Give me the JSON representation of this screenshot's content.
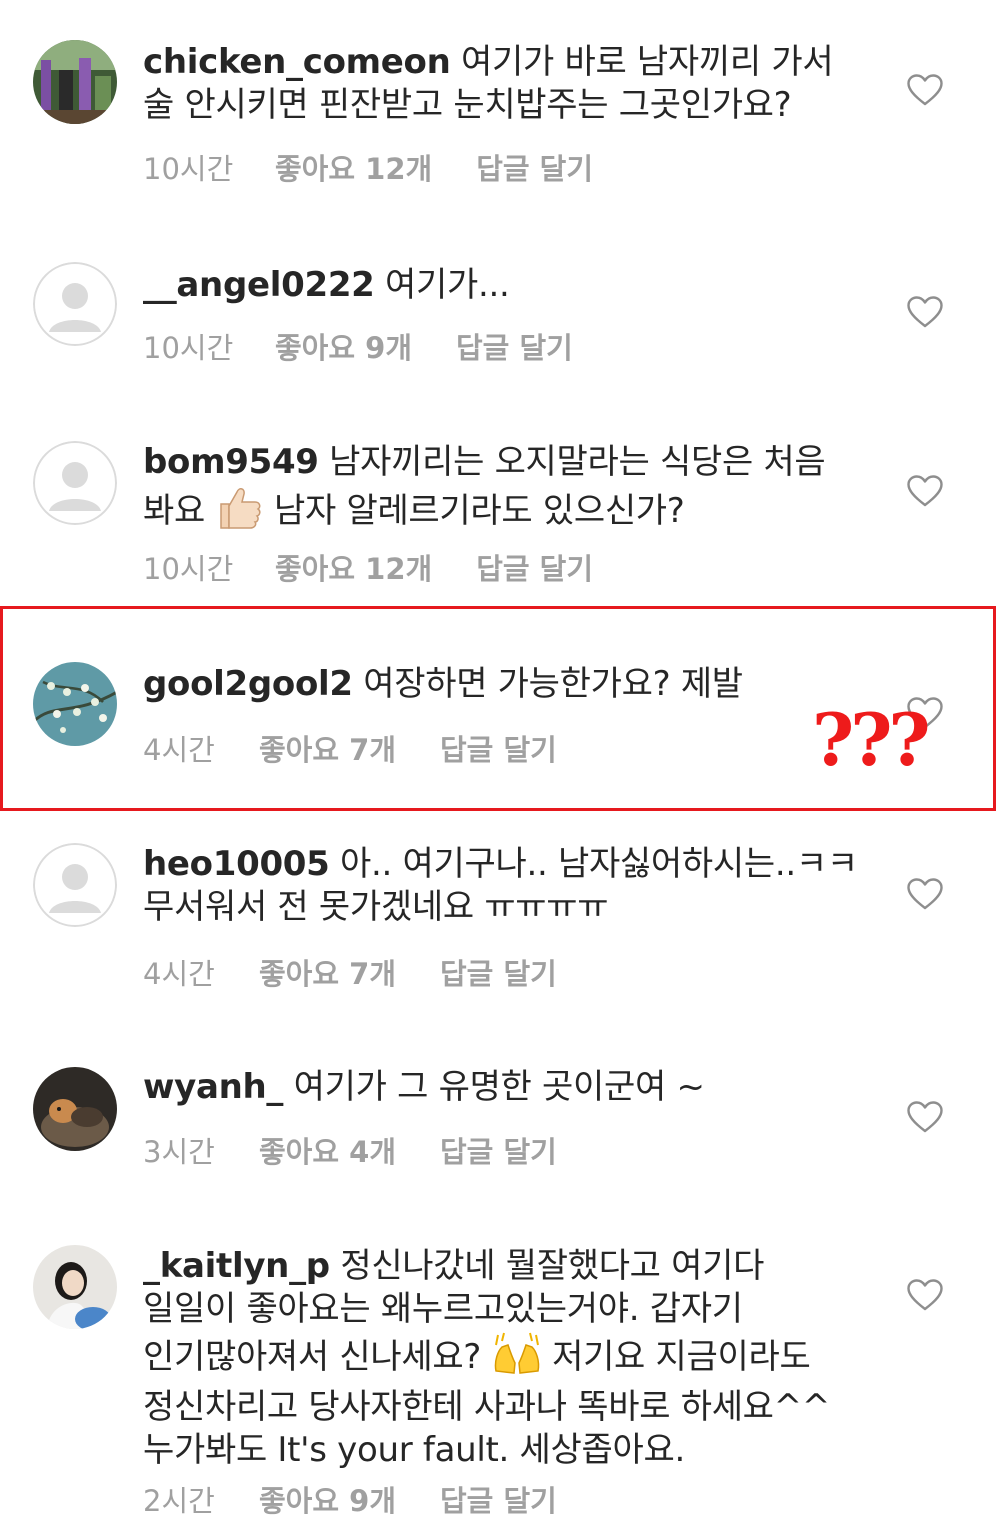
{
  "comments": [
    {
      "username": "chicken_comeon",
      "text": "여기가 바로 남자끼리 가서 술 안시키면 핀잔받고 눈치밥주는 그곳인가요?",
      "time": "10시간",
      "likes": "좋아요 12개",
      "reply": "답글 달기"
    },
    {
      "username": "__angel0222",
      "text": "여기가...",
      "time": "10시간",
      "likes": "좋아요 9개",
      "reply": "답글 달기"
    },
    {
      "username": "bom9549",
      "text_before": "남자끼리는 오지말라는 식당은 처음 봐요",
      "emoji": "thumbs-up-icon",
      "text_after": "남자 알레르기라도 있으신가?",
      "time": "10시간",
      "likes": "좋아요 12개",
      "reply": "답글 달기"
    },
    {
      "username": "gool2gool2",
      "text": "여장하면 가능한가요? 제발",
      "time": "4시간",
      "likes": "좋아요 7개",
      "reply": "답글 달기"
    },
    {
      "username": "heo10005",
      "text": "아.. 여기구나.. 남자싫어하시는..ㅋㅋ 무서워서 전 못가겠네요 ㅠㅠㅠㅠ",
      "time": "4시간",
      "likes": "좋아요 7개",
      "reply": "답글 달기"
    },
    {
      "username": "wyanh_",
      "text": "여기가 그 유명한 곳이군여 ~",
      "time": "3시간",
      "likes": "좋아요 4개",
      "reply": "답글 달기"
    },
    {
      "username": "_kaitlyn_p",
      "text_before": "정신나갔네 뭘잘했다고 여기다 일일이 좋아요는 왜누르고있는거야. 갑자기 인기많아져서 신나세요?",
      "emoji": "raising-hands-icon",
      "text_after": "저기요 지금이라도 정신차리고 당사자한테 사과나 똑바로 하세요^^ 누가봐도 It's your fault. 세상좁아요.",
      "time": "2시간",
      "likes": "좋아요 9개",
      "reply": "답글 달기"
    }
  ],
  "annotation": {
    "text": "???",
    "color": "#ee1b1b",
    "border_color": "#e6191e"
  },
  "icons": {
    "like": "heart-outline-icon",
    "default_avatar": "default-avatar-icon"
  }
}
